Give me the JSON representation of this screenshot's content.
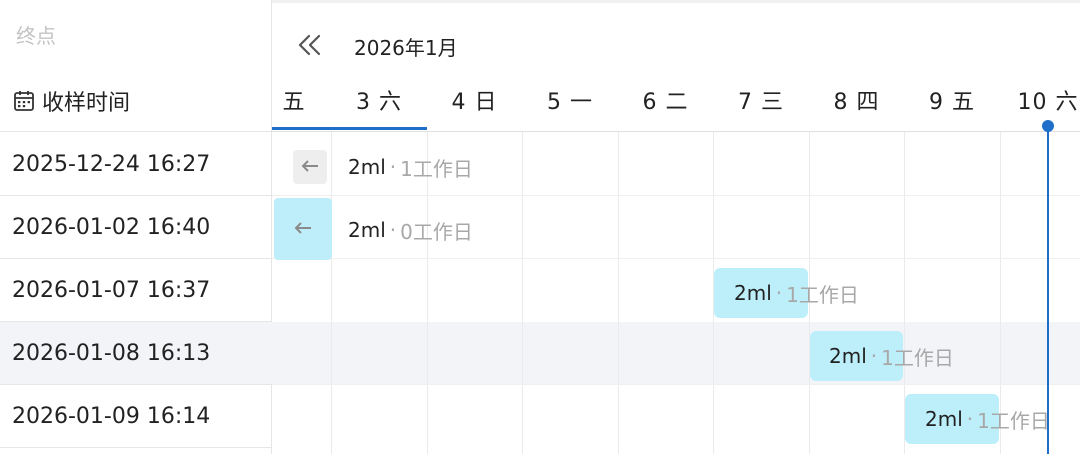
{
  "left": {
    "endpoint_label": "终点",
    "column_header": "收样时间",
    "rows": [
      "2025-12-24 16:27",
      "2026-01-02 16:40",
      "2026-01-07 16:37",
      "2026-01-08 16:13",
      "2026-01-09 16:14"
    ]
  },
  "gantt": {
    "month_label": "2026年1月",
    "days": [
      "五",
      "3 六",
      "4 日",
      "5 一",
      "6 二",
      "7 三",
      "8 四",
      "9 五",
      "10 六"
    ],
    "tasks": [
      {
        "volume": "2ml",
        "sep": "·",
        "duration": "1工作日"
      },
      {
        "volume": "2ml",
        "sep": "·",
        "duration": "0工作日"
      },
      {
        "volume": "2ml",
        "sep": "·",
        "duration": "1工作日"
      },
      {
        "volume": "2ml",
        "sep": "·",
        "duration": "1工作日"
      },
      {
        "volume": "2ml",
        "sep": "·",
        "duration": "1工作日"
      }
    ]
  },
  "colors": {
    "accent": "#1e6fc9",
    "bar": "#bdeffb",
    "row_highlight": "#f3f4f8",
    "muted_text": "#a8a8a8"
  },
  "icons": {
    "calendar": "calendar-icon",
    "double_left": "double-chevron-left-icon",
    "left_arrow": "arrow-left-icon"
  }
}
